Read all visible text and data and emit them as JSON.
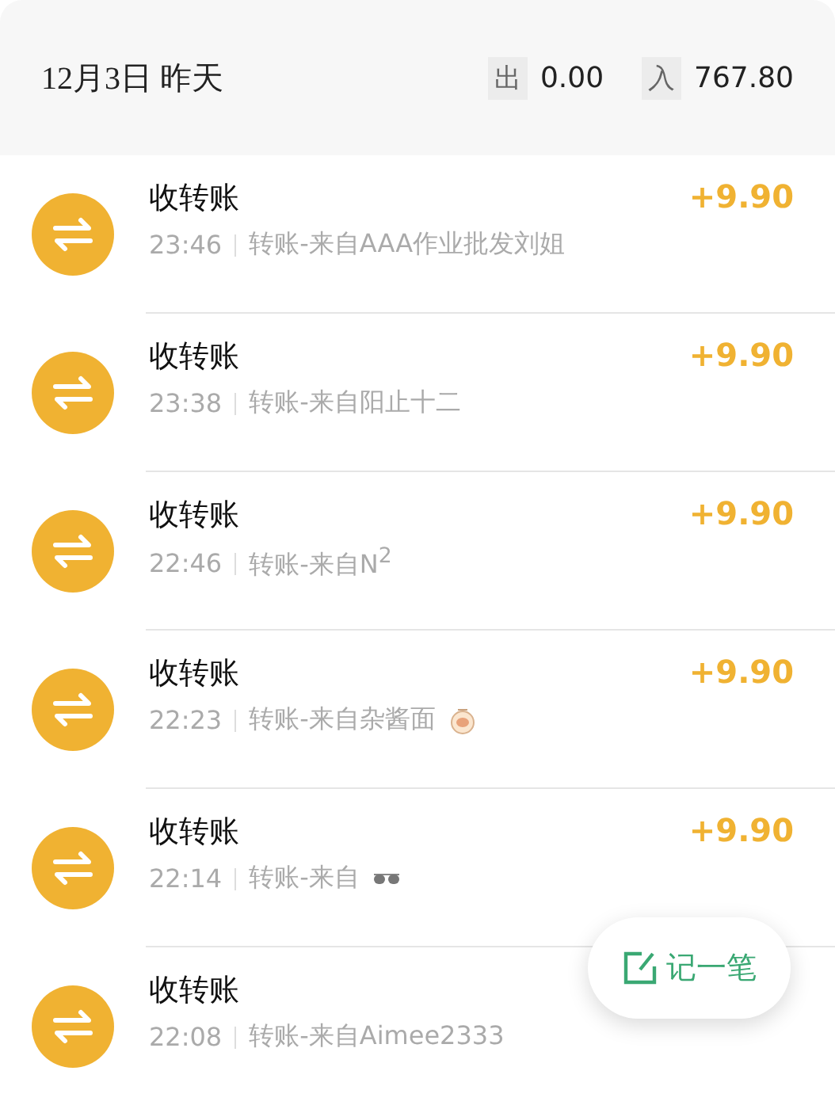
{
  "header": {
    "date": "12月3日 昨天",
    "out_label": "出",
    "out_amount": "0.00",
    "in_label": "入",
    "in_amount": "767.80"
  },
  "transactions": [
    {
      "kind": "plain",
      "title": "收转账",
      "time": "23:46",
      "note": "转账-来自AAA作业批发刘姐",
      "amount": "+9.90"
    },
    {
      "kind": "plain",
      "title": "收转账",
      "time": "23:38",
      "note": "转账-来自阳止十二",
      "amount": "+9.90"
    },
    {
      "kind": "plain",
      "title": "收转账",
      "time": "22:46",
      "note": "转账-来自N$^{2}$",
      "amount": "+9.90"
    },
    {
      "kind": "bowl",
      "title": "收转账",
      "time": "22:23",
      "note": "转账-来自杂酱面",
      "amount": "+9.90"
    },
    {
      "kind": "sunglasses",
      "title": "收转账",
      "time": "22:14",
      "note": "转账-来自",
      "amount": "+9.90"
    },
    {
      "kind": "plain",
      "title": "收转账",
      "time": "22:08",
      "note": "转账-来自Aimee2333"
    }
  ],
  "fab": {
    "label": "记一笔"
  }
}
